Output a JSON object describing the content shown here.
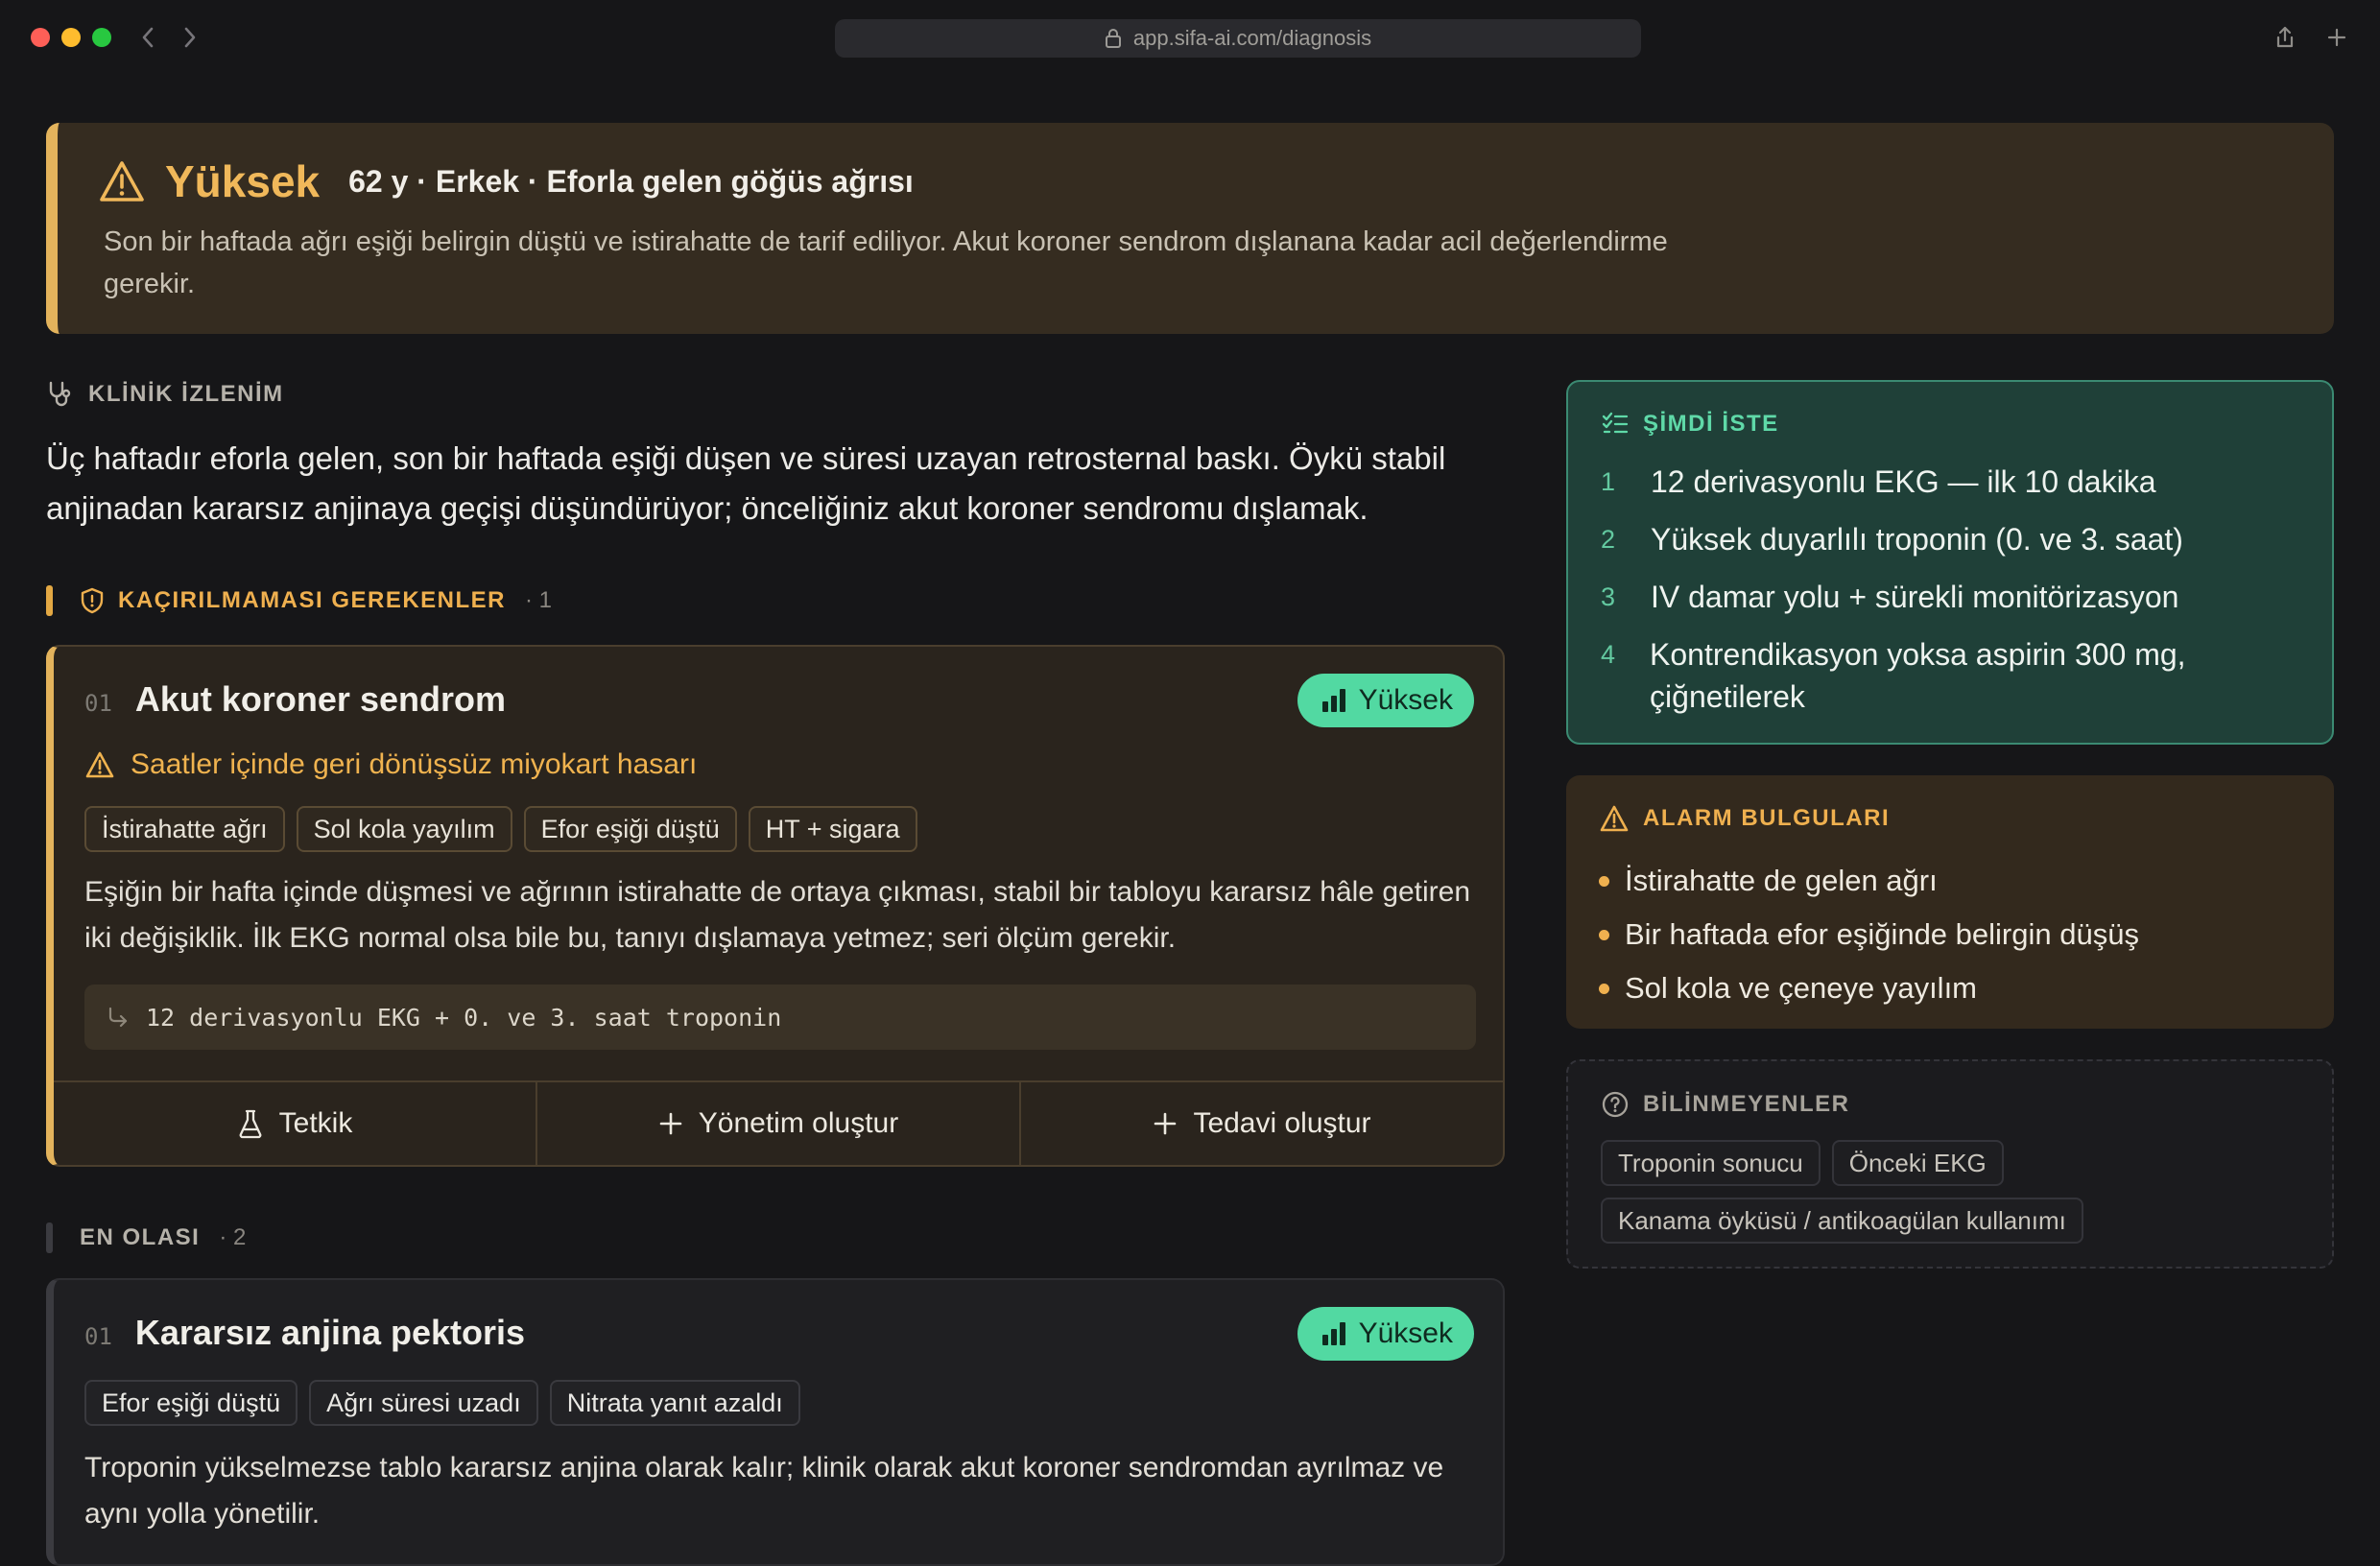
{
  "browser": {
    "url": "app.sifa-ai.com/diagnosis"
  },
  "banner": {
    "level": "Yüksek",
    "meta": "62 y · Erkek · Eforla gelen göğüs ağrısı",
    "description": "Son bir haftada ağrı eşiği belirgin düştü ve istirahatte de tarif ediliyor. Akut koroner sendrom dışlanana kadar acil değerlendirme gerekir."
  },
  "klinik": {
    "label": "KLİNİK İZLENİM",
    "text": "Üç haftadır eforla gelen, son bir haftada eşiği düşen ve süresi uzayan retrosternal baskı. Öykü stabil anjinadan kararsız anjinaya geçişi düşündürüyor; önceliğiniz akut koroner sendromu dışlamak."
  },
  "must_not_miss": {
    "label": "KAÇIRILMAMASI GEREKENLER",
    "count": "· 1",
    "card": {
      "number": "01",
      "title": "Akut koroner sendrom",
      "likelihood": "Yüksek",
      "risk": "Saatler içinde geri dönüşsüz miyokart hasarı",
      "chips": [
        "İstirahatte ağrı",
        "Sol kola yayılım",
        "Efor eşiği düştü",
        "HT + sigara"
      ],
      "body": "Eşiğin bir hafta içinde düşmesi ve ağrının istirahatte de ortaya çıkması, stabil bir tabloyu kararsız hâle getiren iki değişiklik. İlk EKG normal olsa bile bu, tanıyı dışlamaya yetmez; seri ölçüm gerekir.",
      "next_step": "12 derivasyonlu EKG + 0. ve 3. saat troponin",
      "actions": [
        "Tetkik",
        "Yönetim oluştur",
        "Tedavi oluştur"
      ]
    }
  },
  "most_likely": {
    "label": "EN OLASI",
    "count": "· 2",
    "card": {
      "number": "01",
      "title": "Kararsız anjina pektoris",
      "likelihood": "Yüksek",
      "chips": [
        "Efor eşiği düştü",
        "Ağrı süresi uzadı",
        "Nitrata yanıt azaldı"
      ],
      "body": "Troponin yükselmezse tablo kararsız anjina olarak kalır; klinik olarak akut koroner sendromdan ayrılmaz ve aynı yolla yönetilir."
    }
  },
  "do_now": {
    "label": "ŞİMDİ İSTE",
    "items": [
      {
        "n": "1",
        "text": "12 derivasyonlu EKG — ilk 10 dakika"
      },
      {
        "n": "2",
        "text": "Yüksek duyarlılı troponin (0. ve 3. saat)"
      },
      {
        "n": "3",
        "text": "IV damar yolu + sürekli monitörizasyon"
      },
      {
        "n": "4",
        "text": "Kontrendikasyon yoksa aspirin 300 mg, çiğnetilerek"
      }
    ]
  },
  "alarm": {
    "label": "ALARM BULGULARI",
    "items": [
      "İstirahatte de gelen ağrı",
      "Bir haftada efor eşiğinde belirgin düşüş",
      "Sol kola ve çeneye yayılım"
    ]
  },
  "unknowns": {
    "label": "BİLİNMEYENLER",
    "chips": [
      "Troponin sonucu",
      "Önceki EKG",
      "Kanama öyküsü / antikoagülan kullanımı"
    ]
  },
  "colors": {
    "background": "#161618",
    "warning_accent": "#e3b35c",
    "success_accent": "#52d9a2",
    "now_panel": "#1f4038"
  }
}
